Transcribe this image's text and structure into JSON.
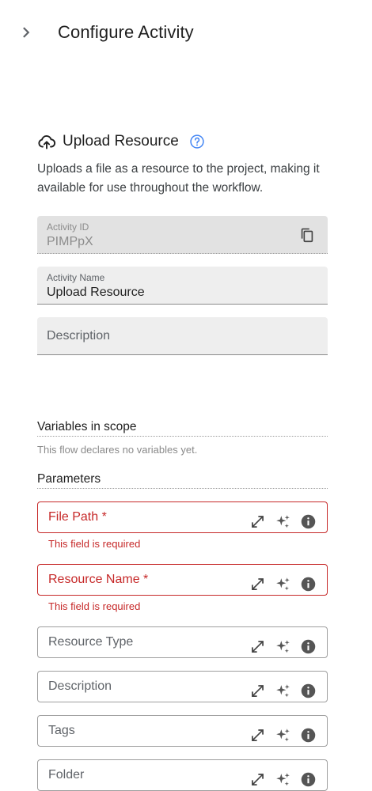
{
  "header": {
    "title": "Configure Activity",
    "back_icon": "chevron-right-icon"
  },
  "activity": {
    "icon": "cloud-upload-icon",
    "title": "Upload Resource",
    "help_icon": "help-circle-icon",
    "description": "Uploads a file as a resource to the project, making it available for use throughout the workflow."
  },
  "fields": {
    "activity_id": {
      "label": "Activity ID",
      "value": "PIMPpX",
      "copy_icon": "copy-icon"
    },
    "activity_name": {
      "label": "Activity Name",
      "value": "Upload Resource"
    },
    "description": {
      "placeholder": "Description"
    }
  },
  "variables": {
    "title": "Variables in scope",
    "empty_text": "This flow declares no variables yet."
  },
  "parameters": {
    "title": "Parameters",
    "required_error": "This field is required",
    "items": [
      {
        "label": "File Path *",
        "required": true
      },
      {
        "label": "Resource Name *",
        "required": true
      },
      {
        "label": "Resource Type",
        "required": false
      },
      {
        "label": "Description",
        "required": false
      },
      {
        "label": "Tags",
        "required": false
      },
      {
        "label": "Folder",
        "required": false
      }
    ],
    "field_icons": [
      "expand-icon",
      "ai-sparkle-icon",
      "info-icon"
    ]
  },
  "colors": {
    "error": "#c62828",
    "help_blue": "#4285f4",
    "text_primary": "#1f1f1f",
    "text_secondary": "#5f6368"
  }
}
